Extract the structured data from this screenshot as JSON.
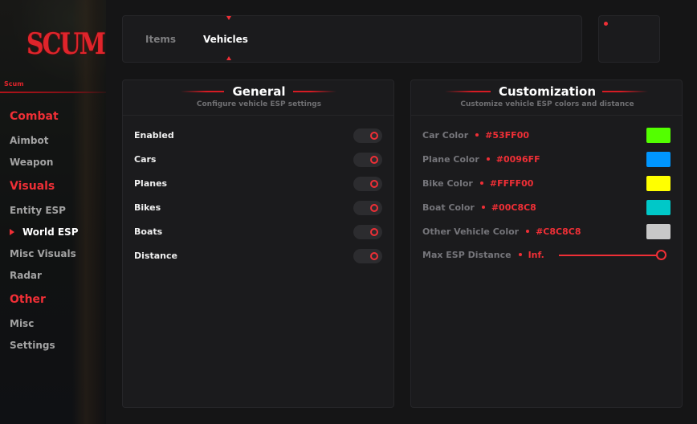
{
  "sidebar": {
    "logo": "SCUM",
    "app_name": "Scum",
    "sections": [
      {
        "heading": "Combat",
        "items": [
          "Aimbot",
          "Weapon"
        ]
      },
      {
        "heading": "Visuals",
        "items": [
          "Entity ESP",
          "World ESP",
          "Misc Visuals",
          "Radar"
        ]
      },
      {
        "heading": "Other",
        "items": [
          "Misc",
          "Settings"
        ]
      }
    ],
    "active_item": "World ESP"
  },
  "tabs": {
    "items": [
      "Items",
      "Vehicles"
    ],
    "active": "Vehicles"
  },
  "general": {
    "title": "General",
    "subtitle": "Configure vehicle ESP settings",
    "rows": [
      "Enabled",
      "Cars",
      "Planes",
      "Bikes",
      "Boats",
      "Distance"
    ],
    "toggle_states": [
      true,
      true,
      true,
      true,
      true,
      true
    ]
  },
  "customization": {
    "title": "Customization",
    "subtitle": "Customize vehicle ESP colors and distance",
    "colors": [
      {
        "label": "Car Color",
        "value": "#53FF00",
        "swatch": "#53FF00"
      },
      {
        "label": "Plane Color",
        "value": "#0096FF",
        "swatch": "#0096FF"
      },
      {
        "label": "Bike Color",
        "value": "#FFFF00",
        "swatch": "#FFFF00"
      },
      {
        "label": "Boat Color",
        "value": "#00C8C8",
        "swatch": "#00C8C8"
      },
      {
        "label": "Other Vehicle Color",
        "value": "#C8C8C8",
        "swatch": "#C8C8C8"
      }
    ],
    "distance": {
      "label": "Max ESP Distance",
      "value": "Inf.",
      "slider_fraction": 1.0
    }
  },
  "theme": {
    "accent": "#EF2F36"
  }
}
